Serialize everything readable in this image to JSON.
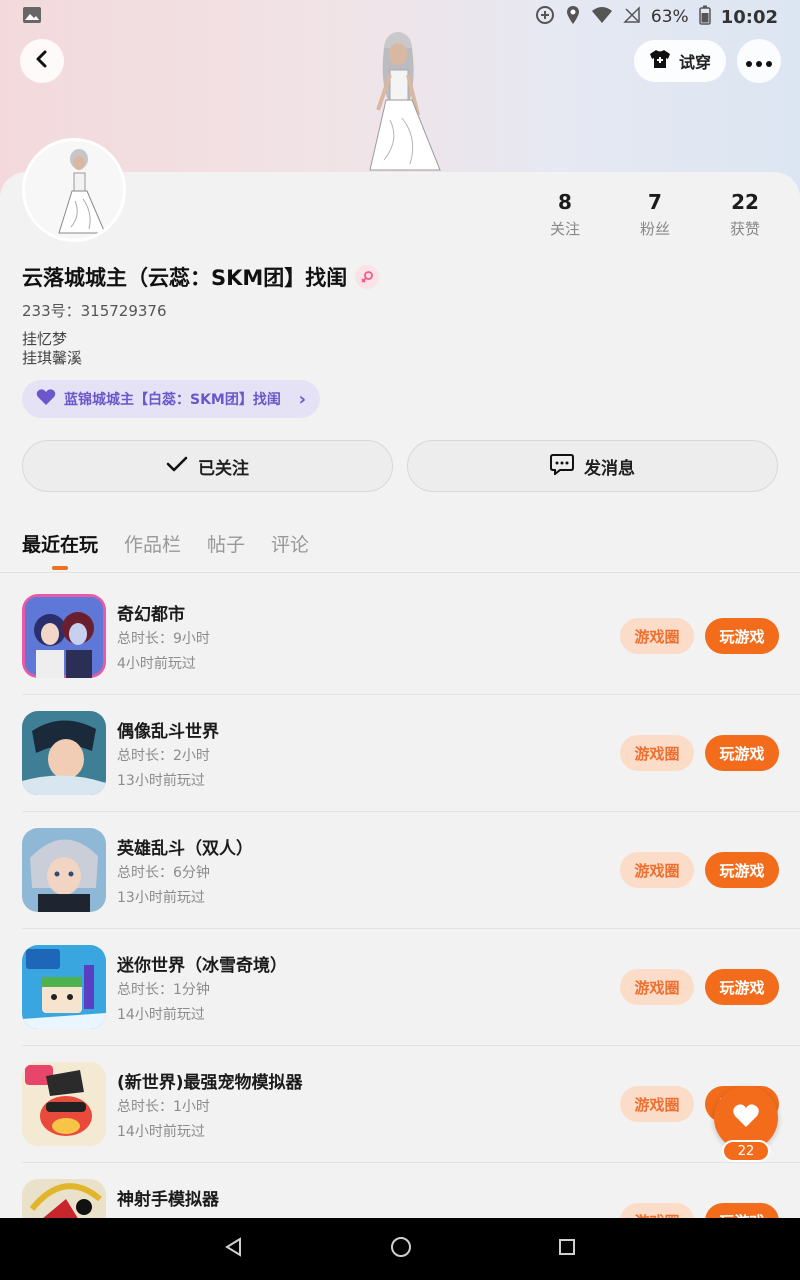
{
  "status_bar": {
    "battery_pct": "63%",
    "time": "10:02"
  },
  "header": {
    "tryon_label": "试穿"
  },
  "profile": {
    "stats": [
      {
        "value": "8",
        "label": "关注"
      },
      {
        "value": "7",
        "label": "粉丝"
      },
      {
        "value": "22",
        "label": "获赞"
      }
    ],
    "name": "云落城城主（云蕊：SKM团】找闺",
    "uid": "233号：315729376",
    "bio_lines": [
      "挂忆梦",
      "挂琪馨溪"
    ],
    "group_chip": "蓝锦城城主【白蕊：SKM团】找闺"
  },
  "actions": {
    "follow_label": "已关注",
    "message_label": "发消息"
  },
  "tabs": [
    "最近在玩",
    "作品栏",
    "帖子",
    "评论"
  ],
  "games": [
    {
      "name": "奇幻都市",
      "duration": "总时长：9小时",
      "last": "4小时前玩过",
      "circle": "游戏圈",
      "play": "玩游戏"
    },
    {
      "name": "偶像乱斗世界",
      "duration": "总时长：2小时",
      "last": "13小时前玩过",
      "circle": "游戏圈",
      "play": "玩游戏"
    },
    {
      "name": "英雄乱斗（双人）",
      "duration": "总时长：6分钟",
      "last": "13小时前玩过",
      "circle": "游戏圈",
      "play": "玩游戏"
    },
    {
      "name": "迷你世界（冰雪奇境）",
      "duration": "总时长：1分钟",
      "last": "14小时前玩过",
      "circle": "游戏圈",
      "play": "玩游戏"
    },
    {
      "name": "(新世界)最强宠物模拟器",
      "duration": "总时长：1小时",
      "last": "14小时前玩过",
      "circle": "游戏圈",
      "play": "玩游戏"
    },
    {
      "name": "神射手模拟器",
      "duration": "",
      "last": "",
      "circle": "游戏圈",
      "play": "玩游戏"
    }
  ],
  "like_fab": {
    "count": "22"
  },
  "colors": {
    "accent": "#f26c1b",
    "accent_light": "#fbdcc9",
    "group_chip_bg": "#e4e2f4",
    "group_chip_text": "#6b57c9"
  }
}
